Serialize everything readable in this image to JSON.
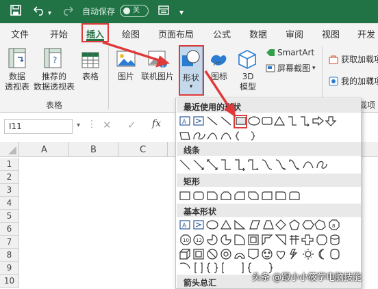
{
  "titlebar": {
    "autosave_label": "自动保存",
    "autosave_state": "关"
  },
  "tabs": [
    "文件",
    "开始",
    "插入",
    "绘图",
    "页面布局",
    "公式",
    "数据",
    "审阅",
    "视图",
    "开发工"
  ],
  "ribbon": {
    "pivot": "数据\n透视表",
    "recommended_pivot": "推荐的\n数据透视表",
    "table": "表格",
    "group_tables": "表格",
    "picture": "图片",
    "online_picture": "联机图片",
    "shapes": "形状",
    "icons": "图标",
    "model3d": "3D\n模型",
    "smartart": "SmartArt",
    "screenshot": "屏幕截图",
    "get_addins": "获取加载项",
    "my_addins": "我的加载项",
    "group_addins": "加载项"
  },
  "formula_bar": {
    "name_box": "I11",
    "fx": "fx"
  },
  "columns": [
    "A",
    "B",
    "C"
  ],
  "rows": [
    "1",
    "2",
    "3",
    "4",
    "5",
    "6",
    "7",
    "8",
    "9",
    "10"
  ],
  "panel": {
    "recent": "最近使用的形状",
    "lines": "线条",
    "rectangles": "矩形",
    "basic": "基本形状",
    "arrows": "箭头总汇"
  },
  "watermark": "头条 @跟小小筱学电脑技能",
  "colors": {
    "excel_green": "#217346",
    "highlight_red": "#e0393a"
  }
}
